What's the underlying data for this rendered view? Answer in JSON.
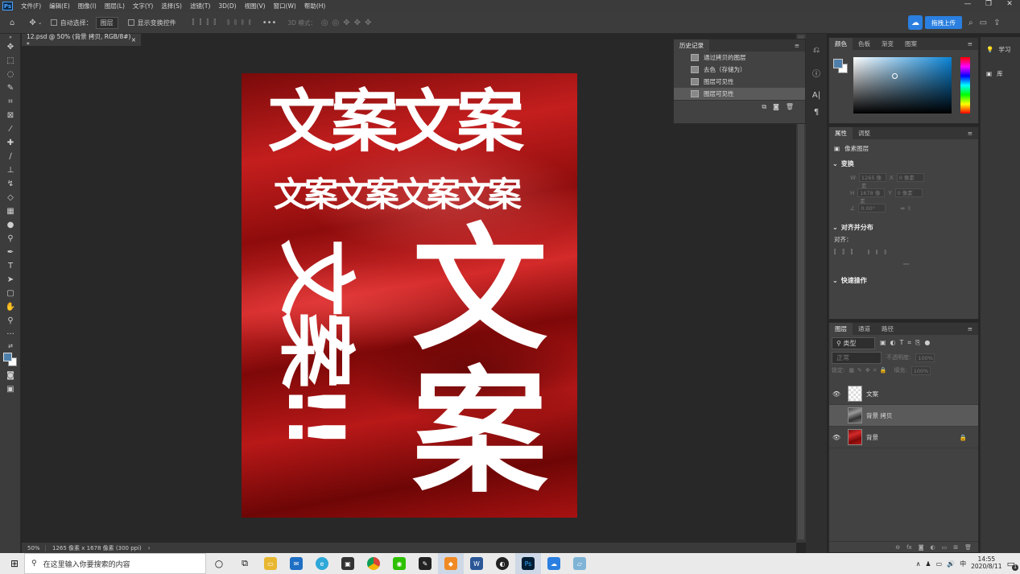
{
  "app": {
    "logo": "Ps"
  },
  "menubar": [
    "文件(F)",
    "编辑(E)",
    "图像(I)",
    "图层(L)",
    "文字(Y)",
    "选择(S)",
    "滤镜(T)",
    "3D(D)",
    "视图(V)",
    "窗口(W)",
    "帮助(H)"
  ],
  "window_controls": [
    "—",
    "❐",
    "✕"
  ],
  "options": {
    "auto_select_label": "自动选择：",
    "auto_select_value": "图层",
    "show_transform_label": "显示变换控件",
    "mode_3d_label": "3D 模式：",
    "upload_button": "拖拽上传"
  },
  "document": {
    "tab_title": "12.psd @ 50% (背景 拷贝, RGB/8#) *",
    "tab_close": "×",
    "zoom": "50%",
    "info": "1265 像素 x 1678 像素 (300 ppi)",
    "canvas_text": {
      "line1": "文案文案",
      "line2": "文案文案文案文案",
      "vertical_left": "文案!!",
      "vertical_right_1": "文",
      "vertical_right_2": "案"
    }
  },
  "history": {
    "tab": "历史记录",
    "items": [
      "通过拷贝的图层",
      "去色（存储为）",
      "图层可见性",
      "图层可见性"
    ],
    "selected_index": 3
  },
  "color_panel": {
    "tabs": [
      "颜色",
      "色板",
      "渐变",
      "图案"
    ],
    "foreground": "#4e7faa",
    "background": "#ffffff"
  },
  "properties": {
    "tabs": [
      "属性",
      "调整"
    ],
    "layer_type": "像素图层",
    "transform_title": "变换",
    "w": "1265 像素",
    "x": "0 像素",
    "h": "1678 像素",
    "y": "0 像素",
    "angle": "0.00°",
    "align_title": "对齐并分布",
    "align_label": "对齐：",
    "quick_title": "快速操作"
  },
  "layers_panel": {
    "tabs": [
      "图层",
      "通道",
      "路径"
    ],
    "filter": "类型",
    "blend": "正常",
    "opacity_label": "不透明度:",
    "opacity": "100%",
    "lock_label": "锁定:",
    "fill_label": "填充:",
    "fill": "100%",
    "layers": [
      {
        "name": "文案",
        "visible": true,
        "selected": false
      },
      {
        "name": "背景 拷贝",
        "visible": false,
        "selected": true
      },
      {
        "name": "背景",
        "visible": true,
        "selected": false,
        "locked": true
      }
    ]
  },
  "right_column": [
    "学习",
    "库"
  ],
  "taskbar": {
    "search_placeholder": "在这里输入你要搜索的内容",
    "ime": "中",
    "time": "14:55",
    "date": "2020/8/11",
    "notif_count": "1"
  },
  "colors": {
    "accent": "#2a7fe0",
    "canvas_red": "#c41e1e"
  }
}
